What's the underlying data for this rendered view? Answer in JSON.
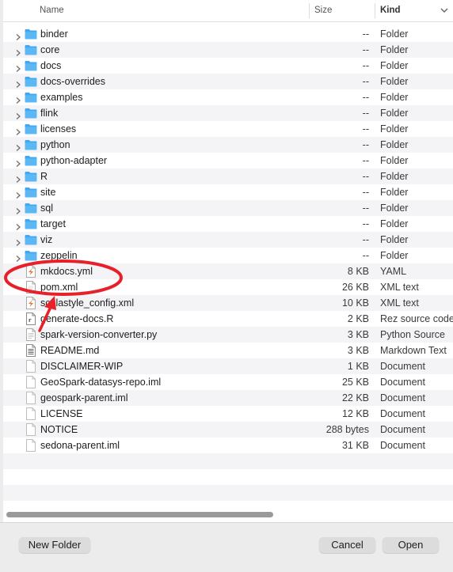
{
  "header": {
    "name": "Name",
    "size": "Size",
    "kind": "Kind"
  },
  "files": [
    {
      "name": "binder",
      "size": "--",
      "kind": "Folder",
      "type": "folder"
    },
    {
      "name": "core",
      "size": "--",
      "kind": "Folder",
      "type": "folder"
    },
    {
      "name": "docs",
      "size": "--",
      "kind": "Folder",
      "type": "folder"
    },
    {
      "name": "docs-overrides",
      "size": "--",
      "kind": "Folder",
      "type": "folder"
    },
    {
      "name": "examples",
      "size": "--",
      "kind": "Folder",
      "type": "folder"
    },
    {
      "name": "flink",
      "size": "--",
      "kind": "Folder",
      "type": "folder"
    },
    {
      "name": "licenses",
      "size": "--",
      "kind": "Folder",
      "type": "folder"
    },
    {
      "name": "python",
      "size": "--",
      "kind": "Folder",
      "type": "folder"
    },
    {
      "name": "python-adapter",
      "size": "--",
      "kind": "Folder",
      "type": "folder"
    },
    {
      "name": "R",
      "size": "--",
      "kind": "Folder",
      "type": "folder"
    },
    {
      "name": "site",
      "size": "--",
      "kind": "Folder",
      "type": "folder"
    },
    {
      "name": "sql",
      "size": "--",
      "kind": "Folder",
      "type": "folder"
    },
    {
      "name": "target",
      "size": "--",
      "kind": "Folder",
      "type": "folder"
    },
    {
      "name": "viz",
      "size": "--",
      "kind": "Folder",
      "type": "folder"
    },
    {
      "name": "zeppelin",
      "size": "--",
      "kind": "Folder",
      "type": "folder"
    },
    {
      "name": "mkdocs.yml",
      "size": "8 KB",
      "kind": "YAML",
      "type": "yaml"
    },
    {
      "name": "pom.xml",
      "size": "26 KB",
      "kind": "XML text",
      "type": "xml"
    },
    {
      "name": "scalastyle_config.xml",
      "size": "10 KB",
      "kind": "XML text",
      "type": "yaml"
    },
    {
      "name": "generate-docs.R",
      "size": "2 KB",
      "kind": "Rez source code",
      "type": "r"
    },
    {
      "name": "spark-version-converter.py",
      "size": "3 KB",
      "kind": "Python Source",
      "type": "doc"
    },
    {
      "name": "README.md",
      "size": "3 KB",
      "kind": "Markdown Text",
      "type": "md"
    },
    {
      "name": "DISCLAIMER-WIP",
      "size": "1 KB",
      "kind": "Document",
      "type": "blank"
    },
    {
      "name": "GeoSpark-datasys-repo.iml",
      "size": "25 KB",
      "kind": "Document",
      "type": "blank"
    },
    {
      "name": "geospark-parent.iml",
      "size": "22 KB",
      "kind": "Document",
      "type": "blank"
    },
    {
      "name": "LICENSE",
      "size": "12 KB",
      "kind": "Document",
      "type": "blank"
    },
    {
      "name": "NOTICE",
      "size": "288 bytes",
      "kind": "Document",
      "type": "blank"
    },
    {
      "name": "sedona-parent.iml",
      "size": "31 KB",
      "kind": "Document",
      "type": "blank"
    }
  ],
  "buttons": {
    "new_folder": "New Folder",
    "cancel": "Cancel",
    "open": "Open"
  },
  "colors": {
    "folder": "#41a7f0",
    "annotation": "#e8202a",
    "yaml_accent": "#e8762c"
  }
}
